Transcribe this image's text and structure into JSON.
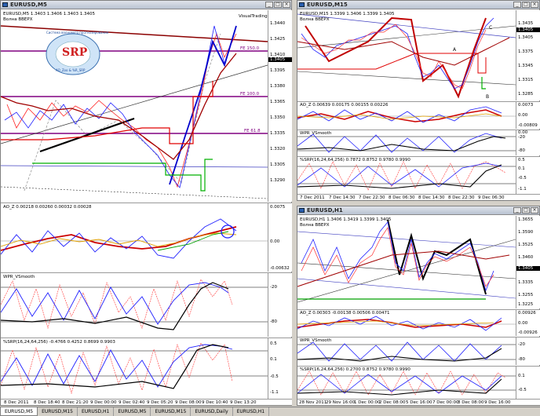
{
  "left": {
    "title": "EURUSD,M5",
    "ohlc": "EURUSD,M5  1.3403 1.3406 1.3403 1.3405",
    "wave": "Волна BBEPX",
    "watermark": "VisualTrading",
    "price_axis": [
      "1.3440",
      "1.3425",
      "1.3410",
      "1.3395",
      "1.3380",
      "1.3365",
      "1.3350",
      "1.3335",
      "1.3320",
      "1.3305",
      "1.3290"
    ],
    "price_flag": "1.3405",
    "fe_levels": [
      "FE 150.0",
      "FE 100.0",
      "FE 61.8"
    ],
    "ao_label": "AO_Z 0.00218 0.00260 0.00032 0.00028",
    "ao_axis": [
      "0.0075",
      "0.00",
      "-0.00632"
    ],
    "wpr_label": "WPR_VSmooth",
    "wpr_axis": [
      "-20",
      "-80"
    ],
    "srp_label": "%SRP(16,24,64,256) -0.4766 0.4252 0.8699 0.9903",
    "srp_axis": [
      "0.5",
      "0.1",
      "-0.5",
      "-1.1"
    ],
    "time_axis": [
      "8 Dec 2011",
      "8 Dec 18:40",
      "8 Dec 21:20",
      "9 Dec 00:00",
      "9 Dec 02:40",
      "9 Dec 05:20",
      "9 Dec 08:00",
      "9 Dec 10:40",
      "9 Dec 13:20"
    ]
  },
  "right_top": {
    "title": "EURUSD,M15",
    "ohlc": "EURUSD,M15  1.3399 1.3406 1.3399 1.3405",
    "wave": "Волна BBEPX",
    "price_axis": [
      "1.3435",
      "1.3405",
      "1.3375",
      "1.3345",
      "1.3315",
      "1.3285"
    ],
    "price_flag": "1.3405",
    "points": [
      "A",
      "B",
      "C"
    ],
    "ao_label": "AO_Z 0.00639 0.00175 0.00155 0.00226",
    "ao_axis": [
      "0.0073",
      "0.00",
      "-0.00809"
    ],
    "wpr_label": "WPR_VSmooth",
    "wpr_axis": [
      "0.00",
      "-20",
      "-80"
    ],
    "srp_label": "%SRP(16,24,64,256) 0.7872 0.8752 0.9780 0.9990",
    "srp_axis": [
      "0.5",
      "0.1",
      "-0.5",
      "-1.1"
    ],
    "time_axis": [
      "7 Dec 2011",
      "7 Dec 14:30",
      "7 Dec 22:30",
      "8 Dec 06:30",
      "8 Dec 14:30",
      "8 Dec 22:30",
      "9 Dec 06:30"
    ]
  },
  "right_bottom": {
    "title": "EURUSD,H1",
    "ohlc": "EURUSD,H1  1.3406 1.3419 1.3399 1.3405",
    "wave": "Волна BBEPX",
    "price_axis": [
      "1.3655",
      "1.3590",
      "1.3525",
      "1.3460",
      "1.3405",
      "1.3335",
      "1.3255",
      "1.3225"
    ],
    "price_flag": "1.3405",
    "ao_label": "AO_Z 0.00303 -0.00138 0.00506 0.00471",
    "ao_axis": [
      "0.00926",
      "0.00",
      "-0.00926"
    ],
    "wpr_label": "WPR_VSmooth",
    "wpr_axis": [
      "-20",
      "-80"
    ],
    "srp_label": "%SRP(16,24,64,256) 0.2700 0.8752 0.9780 0.9990",
    "srp_axis": [
      "0.1",
      "-0.5"
    ],
    "time_axis": [
      "28 Nov 2011",
      "29 Nov 16:00",
      "1 Dec 00:00",
      "2 Dec 08:00",
      "5 Dec 16:00",
      "7 Dec 00:00",
      "8 Dec 08:00",
      "9 Dec 16:00"
    ]
  },
  "logo": {
    "text": "SRP",
    "caption": "Система волнового прогнозирования",
    "sub": "AO_Zoo & %R_SRP"
  },
  "tabs": [
    "EURUSD,M5",
    "EURUSD,M15",
    "EURUSD,H1",
    "EURUSD,M5",
    "EURUSD,M15",
    "EURUSD,Daily",
    "EURUSD,H1"
  ]
}
